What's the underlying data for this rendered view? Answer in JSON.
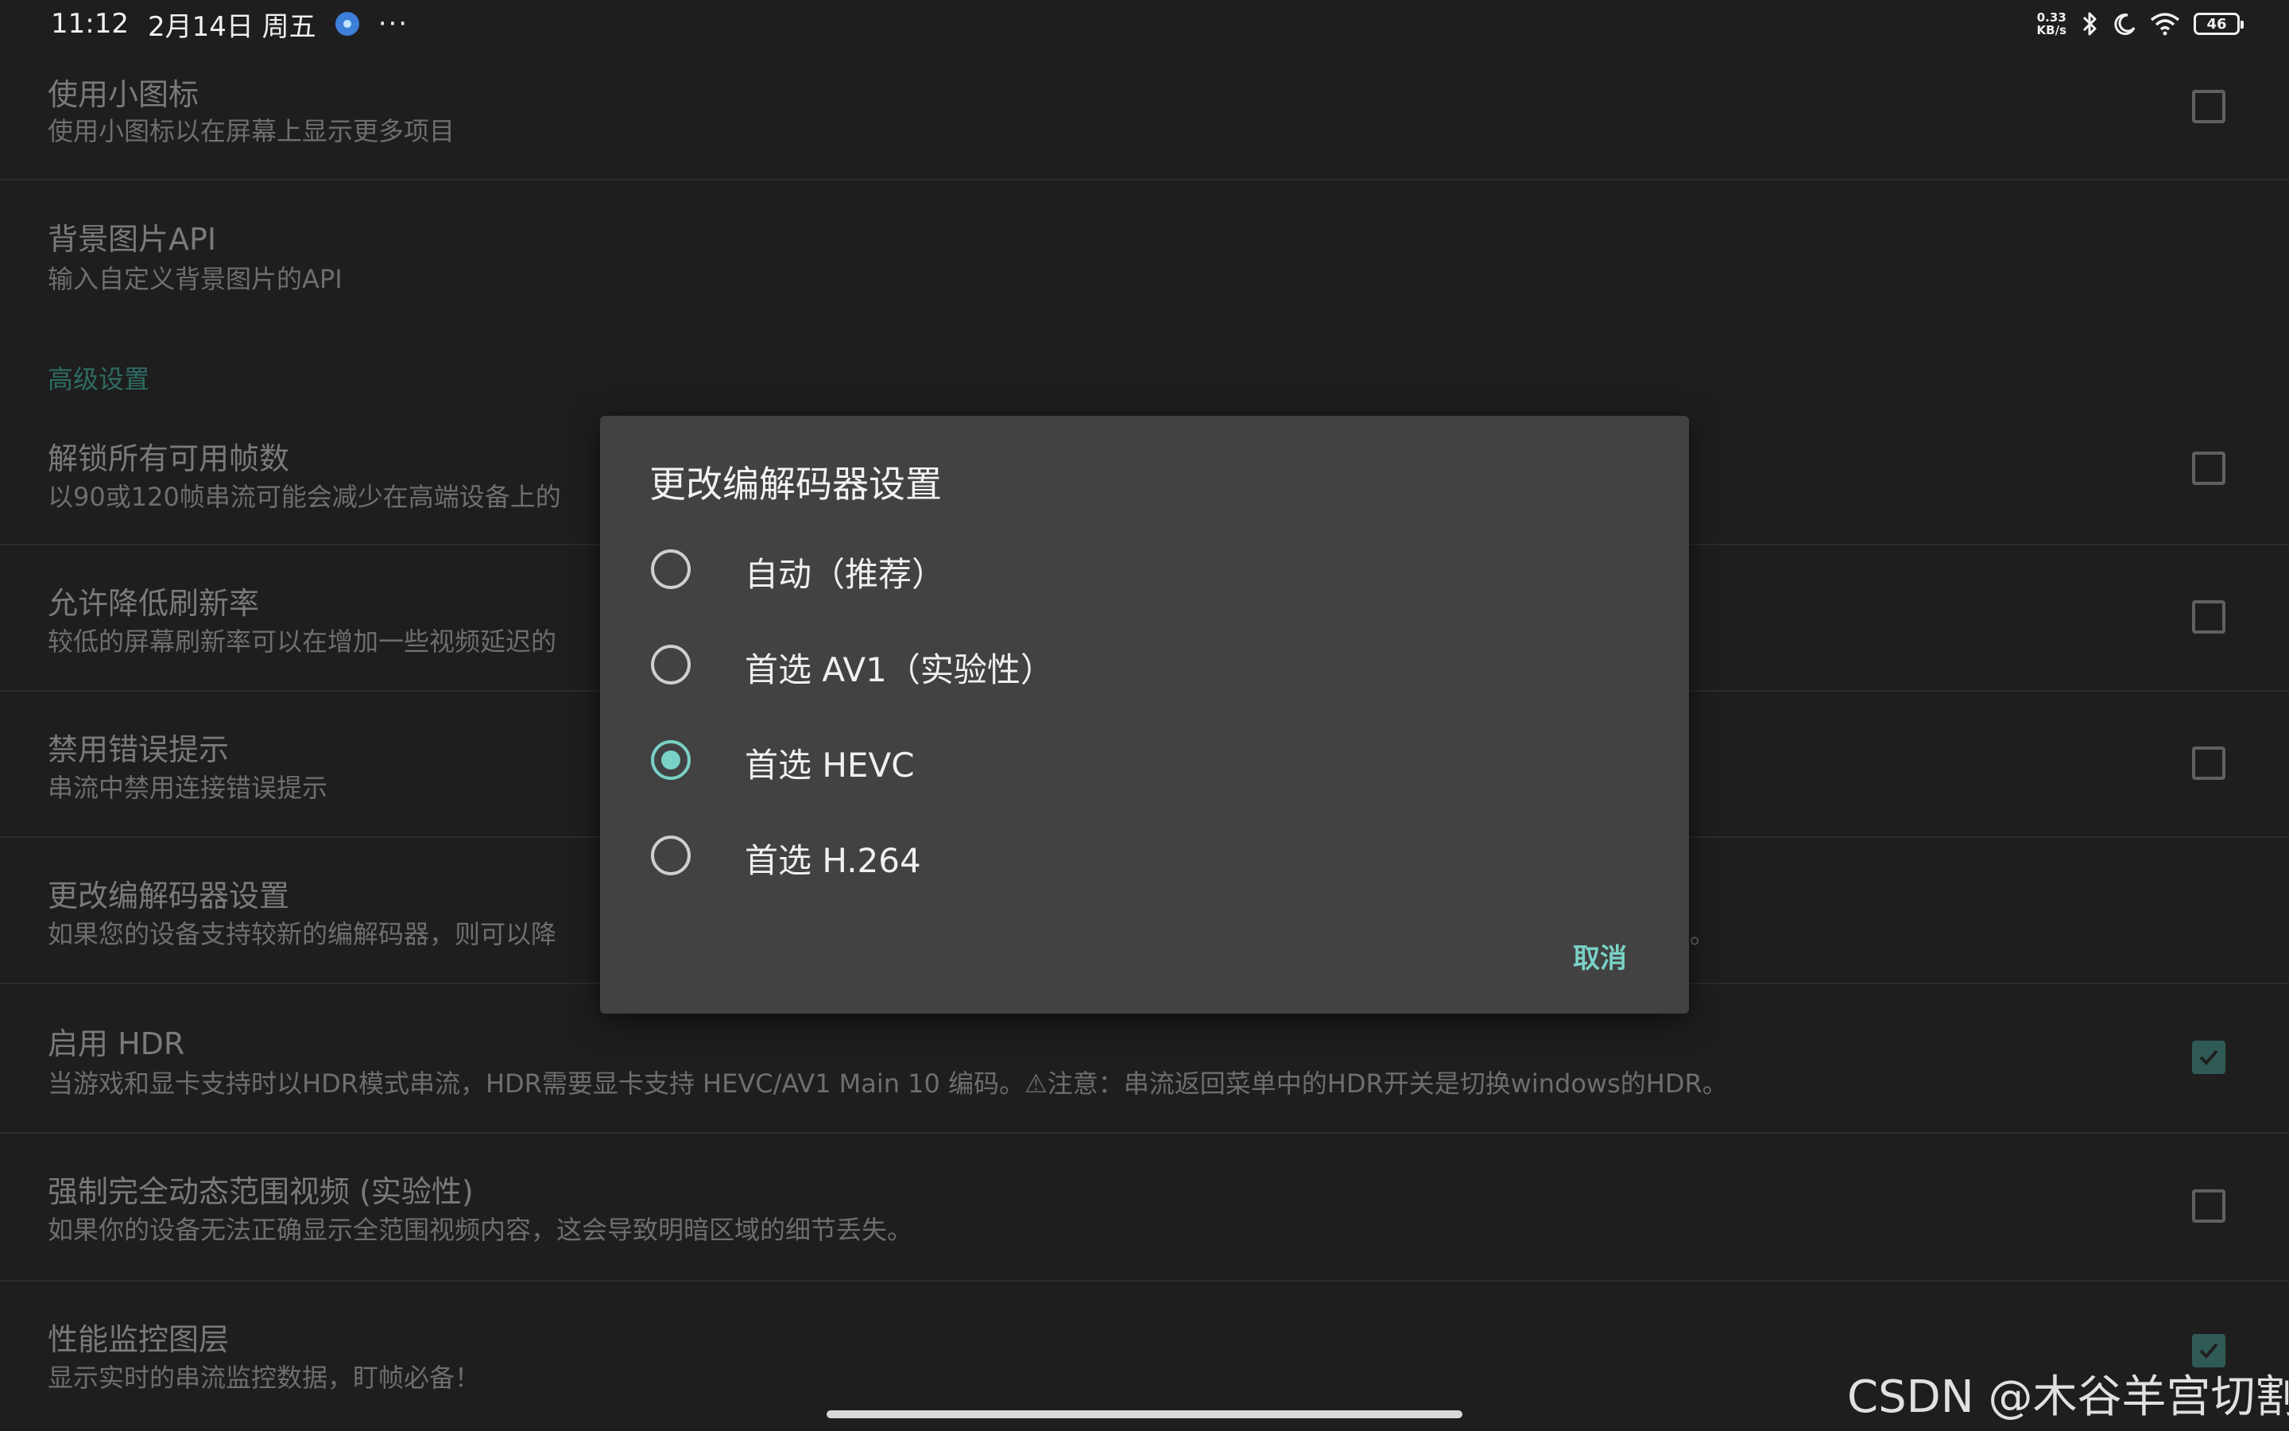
{
  "status_bar": {
    "time": "11:12",
    "date": "2月14日 周五",
    "more": "···",
    "net_speed_value": "0.33",
    "net_speed_unit": "KB/s",
    "battery": "46"
  },
  "settings": {
    "section_advanced": "高级设置",
    "rows": [
      {
        "title": "使用小图标",
        "summary": "使用小图标以在屏幕上显示更多项目",
        "checkbox": true,
        "checked": false
      },
      {
        "title": "背景图片API",
        "summary": "输入自定义背景图片的API",
        "checkbox": false
      },
      {
        "title": "解锁所有可用帧数",
        "summary": "以90或120帧串流可能会减少在高端设备上的",
        "checkbox": true,
        "checked": false
      },
      {
        "title": "允许降低刷新率",
        "summary": "较低的屏幕刷新率可以在增加一些视频延迟的",
        "checkbox": true,
        "checked": false
      },
      {
        "title": "禁用错误提示",
        "summary": "串流中禁用连接错误提示",
        "checkbox": true,
        "checked": false
      },
      {
        "title": "更改编解码器设置",
        "summary": "如果您的设备支持较新的编解码器，则可以降",
        "summary_tail": "。",
        "checkbox": false
      },
      {
        "title": "启用 HDR",
        "summary": "当游戏和显卡支持时以HDR模式串流，HDR需要显卡支持 HEVC/AV1 Main 10 编码。⚠注意：串流返回菜单中的HDR开关是切换windows的HDR。",
        "checkbox": true,
        "checked": true
      },
      {
        "title": "强制完全动态范围视频 (实验性)",
        "summary": "如果你的设备无法正确显示全范围视频内容，这会导致明暗区域的细节丢失。",
        "checkbox": true,
        "checked": false
      },
      {
        "title": "性能监控图层",
        "summary": "显示实时的串流监控数据，盯帧必备！",
        "checkbox": true,
        "checked": true
      }
    ]
  },
  "dialog": {
    "title": "更改编解码器设置",
    "options": [
      {
        "label": "自动（推荐）",
        "selected": false
      },
      {
        "label": "首选 AV1（实验性）",
        "selected": false
      },
      {
        "label": "首选 HEVC",
        "selected": true
      },
      {
        "label": "首选 H.264",
        "selected": false
      }
    ],
    "cancel_label": "取消"
  },
  "watermark": "CSDN @木谷羊宫切割",
  "colors": {
    "background": "#1e1e1e",
    "dialog_bg": "#424242",
    "accent": "#7ad1c6",
    "section_header": "#2e6c63"
  }
}
